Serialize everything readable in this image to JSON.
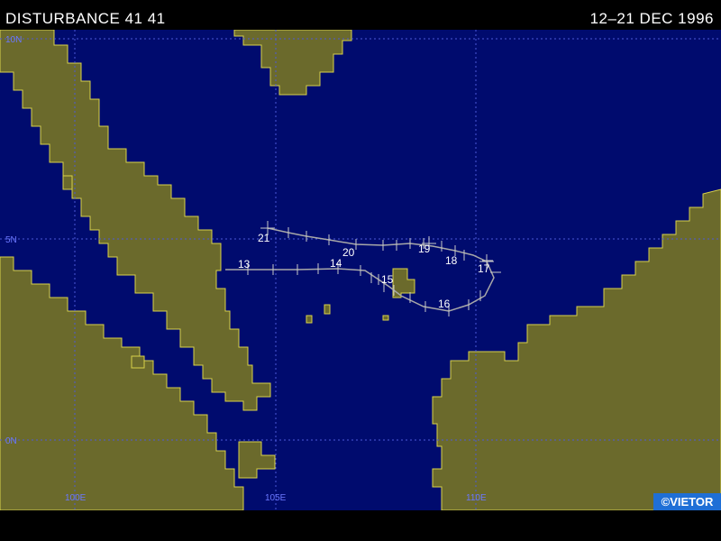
{
  "header": {
    "title": "DISTURBANCE 41 41",
    "dates": "12–21 DEC 1996"
  },
  "credit": "©VIETOR",
  "colors": {
    "ocean": "#000b6e",
    "land": "#6b6a2c",
    "coast": "#d8d24a",
    "grid": "#4c59d8",
    "track": "#a8a8a8"
  },
  "grid_labels": {
    "lat_top": "10N",
    "lat_mid": "5N",
    "lat_bottom": "0N",
    "lon_100": "100E",
    "lon_105": "105E",
    "lon_110": "110E"
  },
  "track_labels": [
    "13",
    "14",
    "15",
    "16",
    "17",
    "18",
    "19",
    "20",
    "21"
  ]
}
